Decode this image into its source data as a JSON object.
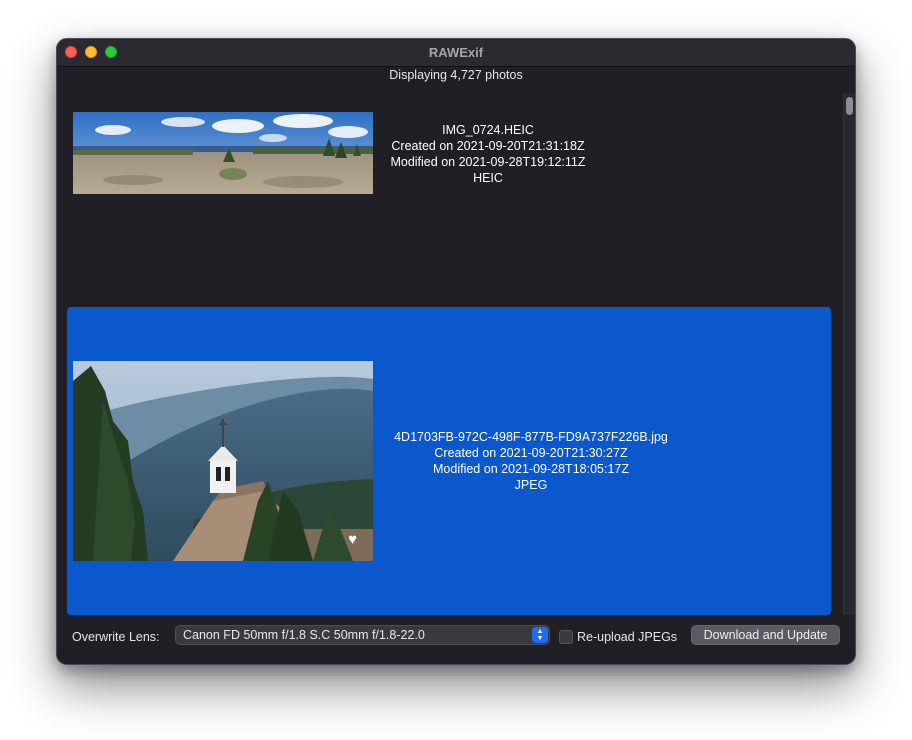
{
  "window": {
    "title": "RAWExif"
  },
  "status": {
    "text": "Displaying 4,727 photos"
  },
  "photos": [
    {
      "filename": "IMG_0724.HEIC",
      "created": "Created on 2021-09-20T21:31:18Z",
      "modified": "Modified on 2021-09-28T19:12:11Z",
      "format": "HEIC",
      "favorite": false,
      "selected": false
    },
    {
      "filename": "4D1703FB-972C-498F-877B-FD9A737F226B.jpg",
      "created": "Created on 2021-09-20T21:30:27Z",
      "modified": "Modified on 2021-09-28T18:05:17Z",
      "format": "JPEG",
      "favorite": true,
      "selected": true
    }
  ],
  "controls": {
    "lens_label": "Overwrite Lens:",
    "lens_value": "Canon FD 50mm f/1.8 S.C 50mm f/1.8-22.0",
    "reupload_label": "Re-upload JPEGs",
    "reupload_checked": false,
    "download_label": "Download and Update"
  },
  "icons": {
    "heart": "heart-icon",
    "select_arrows": "chevron-up-down-icon"
  },
  "colors": {
    "selection": "#0a58cc",
    "background": "#211f26",
    "accent": "#1c6ef2"
  }
}
